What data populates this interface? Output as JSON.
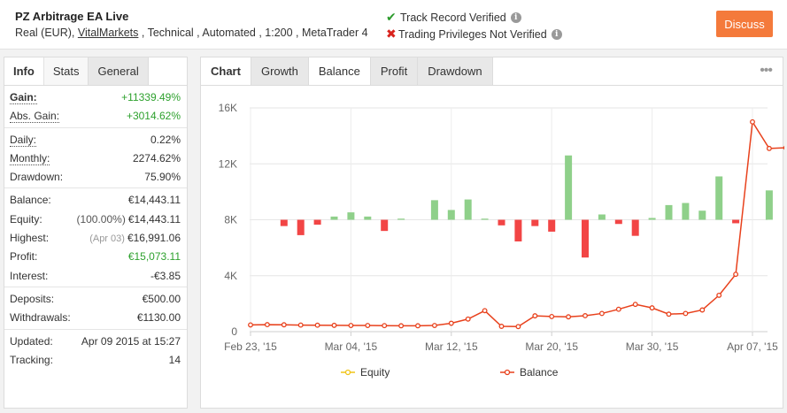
{
  "header": {
    "title": "PZ Arbitrage EA Live",
    "meta_pre": "Real (EUR), ",
    "meta_link": "VitalMarkets",
    "meta_post": " , Technical , Automated , 1:200 , MetaTrader 4",
    "verified": "Track Record Verified",
    "not_verified": "Trading Privileges Not Verified",
    "discuss": "Discuss"
  },
  "left_tabs": [
    "Info",
    "Stats",
    "General"
  ],
  "stats": {
    "gain": {
      "label": "Gain:",
      "value": "+11339.49%"
    },
    "abs_gain": {
      "label": "Abs. Gain:",
      "value": "+3014.62%"
    },
    "daily": {
      "label": "Daily:",
      "value": "0.22%"
    },
    "monthly": {
      "label": "Monthly:",
      "value": "2274.62%"
    },
    "drawdown": {
      "label": "Drawdown:",
      "value": "75.90%"
    },
    "balance": {
      "label": "Balance:",
      "value": "€14,443.11"
    },
    "equity": {
      "label": "Equity:",
      "note": "(100.00%)",
      "value": "€14,443.11"
    },
    "highest": {
      "label": "Highest:",
      "note": "(Apr 03)",
      "value": "€16,991.06"
    },
    "profit": {
      "label": "Profit:",
      "value": "€15,073.11"
    },
    "interest": {
      "label": "Interest:",
      "value": "-€3.85"
    },
    "deposits": {
      "label": "Deposits:",
      "value": "€500.00"
    },
    "withdrawals": {
      "label": "Withdrawals:",
      "value": "€1130.00"
    },
    "updated": {
      "label": "Updated:",
      "value": "Apr 09 2015 at 15:27"
    },
    "tracking": {
      "label": "Tracking:",
      "value": "14"
    }
  },
  "chart_tabs": [
    "Chart",
    "Growth",
    "Balance",
    "Profit",
    "Drawdown"
  ],
  "more_glyph": "•••",
  "colors": {
    "accent": "#f47a3b",
    "profit_bar": "#8fd08a",
    "loss_bar": "#f24545",
    "balance_line": "#e8411c",
    "equity_line": "#f0c419"
  },
  "chart_data": {
    "type": "bar+line",
    "y_ticks": [
      "0",
      "4K",
      "8K",
      "12K",
      "16K"
    ],
    "ylim": [
      0,
      16000
    ],
    "x_tick_labels": [
      "Feb 23, '15",
      "Mar 04, '15",
      "Mar 12, '15",
      "Mar 20, '15",
      "Mar 30, '15",
      "Apr 07, '15"
    ],
    "x_tick_index": [
      0,
      6,
      12,
      18,
      24,
      30
    ],
    "bar_baseline": 8000,
    "bars": [
      -450,
      -1100,
      -350,
      230,
      530,
      230,
      -800,
      80,
      1400,
      700,
      1450,
      80,
      -400,
      -1550,
      -450,
      -850,
      4600,
      -2700,
      380,
      -300,
      -1150,
      130,
      1050,
      1200,
      650,
      3100,
      -250,
      2100
    ],
    "bar_index": [
      2,
      3,
      4,
      5,
      6,
      7,
      8,
      9,
      11,
      12,
      13,
      14,
      15,
      16,
      17,
      18,
      19,
      20,
      21,
      22,
      23,
      24,
      25,
      26,
      27,
      28,
      29,
      31
    ],
    "balance": [
      480,
      500,
      490,
      470,
      460,
      450,
      440,
      440,
      430,
      420,
      420,
      440,
      600,
      900,
      1500,
      380,
      360,
      1130,
      1080,
      1060,
      1140,
      1300,
      1600,
      1950,
      1700,
      1250,
      1300,
      1550,
      2600,
      4100,
      15000,
      13100,
      13150,
      14450
    ],
    "balance_index": [
      0,
      1,
      2,
      3,
      4,
      5,
      6,
      7,
      8,
      9,
      10,
      11,
      12,
      13,
      14,
      15,
      16,
      17,
      18,
      19,
      20,
      21,
      22,
      23,
      24,
      25,
      26,
      27,
      28,
      29,
      30,
      31,
      32,
      33
    ],
    "legend": [
      "Equity",
      "Balance"
    ]
  }
}
